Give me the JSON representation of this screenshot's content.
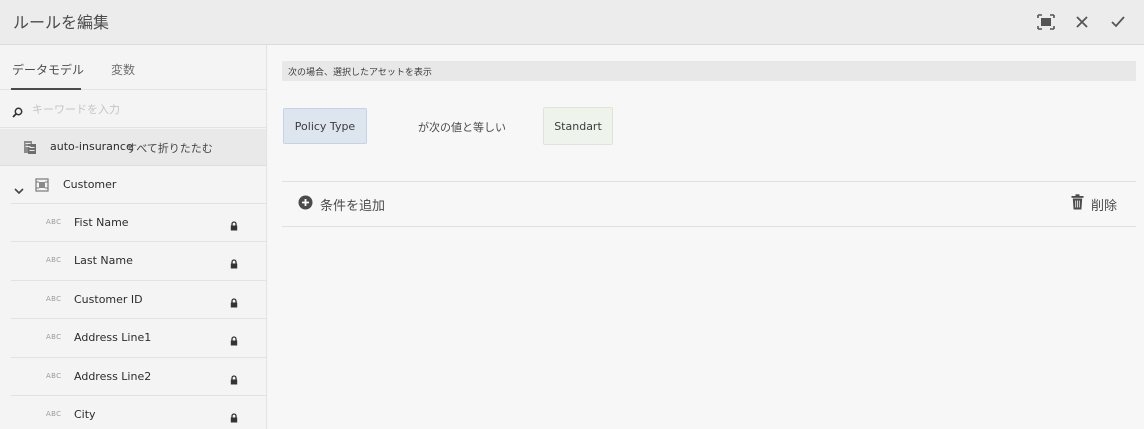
{
  "header": {
    "title": "ルールを編集",
    "icons": [
      "fullscreen-icon",
      "close-icon",
      "checkmark-icon"
    ]
  },
  "sidebar": {
    "tabs": [
      {
        "label": "データモデル",
        "active": true
      },
      {
        "label": "変数",
        "active": false
      }
    ],
    "search": {
      "placeholder": "キーワードを入力",
      "value": ""
    },
    "model": {
      "name": "auto-insurance",
      "collapse_label": "すべて折りたたむ"
    },
    "entity": {
      "name": "Customer",
      "expanded": true
    },
    "fields": [
      {
        "type": "ABC",
        "name": "Fist Name"
      },
      {
        "type": "ABC",
        "name": "Last Name"
      },
      {
        "type": "ABC",
        "name": "Customer ID"
      },
      {
        "type": "ABC",
        "name": "Address Line1"
      },
      {
        "type": "ABC",
        "name": "Address Line2"
      },
      {
        "type": "ABC",
        "name": "City"
      }
    ]
  },
  "rule": {
    "condition_header": "次の場合、選択したアセットを表示",
    "variable": "Policy Type",
    "operator": "が次の値と等しい",
    "value": "Standart",
    "add_condition_label": "条件を追加",
    "delete_label": "削除"
  },
  "colors": {
    "variable_chip": "#dde5ef",
    "value_chip": "#eef3ec",
    "header_bg": "#ececec"
  }
}
